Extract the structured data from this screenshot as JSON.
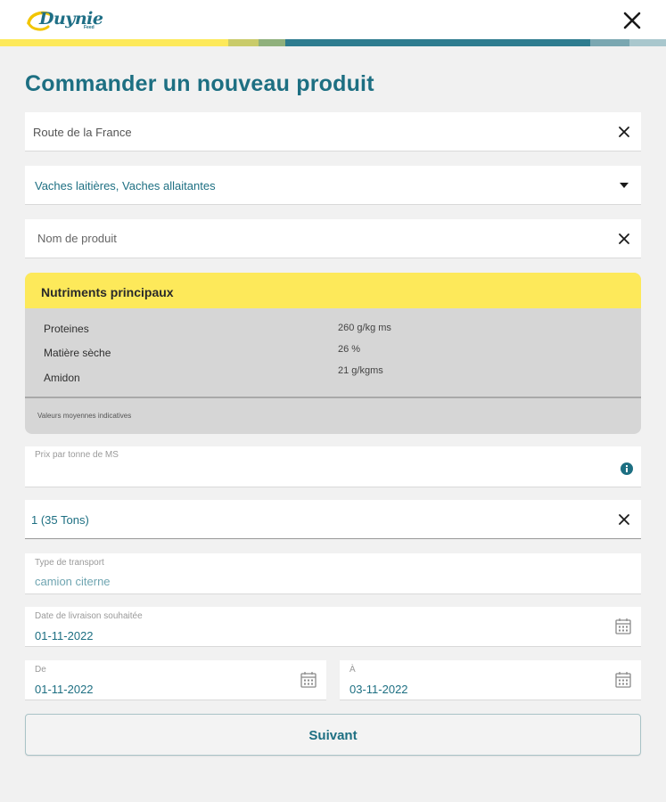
{
  "brand": {
    "name": "Duynie",
    "sub": "Feed"
  },
  "colors": {
    "teal": "#1d6f82",
    "yellow": "#fde95a",
    "bar": [
      "#fde95a",
      "#c9cb6a",
      "#8fb07c",
      "#2e7c8f",
      "#7aa7b1",
      "#a9c7cd"
    ]
  },
  "page": {
    "title": "Commander un nouveau produit"
  },
  "form": {
    "route": "Route de la France",
    "animals": "Vaches laitières, Vaches allaitantes",
    "product_placeholder": "Nom de produit",
    "price_label": "Prix par tonne de MS",
    "quantity": "1 (35 Tons)",
    "transport_label": "Type de transport",
    "transport_value": "camion citerne",
    "delivery_label": "Date de livraison souhaitée",
    "delivery_value": "01-11-2022",
    "from_label": "De",
    "from_value": "01-11-2022",
    "to_label": "À",
    "to_value": "03-11-2022"
  },
  "nutrients": {
    "title": "Nutriments principaux",
    "rows": [
      {
        "name": "Proteines",
        "value": "260 g/kg ms"
      },
      {
        "name": "Matière sèche",
        "value": "26 %"
      },
      {
        "name": "Amidon",
        "value": "21 g/kgms"
      }
    ],
    "footer": "Valeurs moyennes indicatives"
  },
  "actions": {
    "next": "Suivant"
  },
  "icons": [
    "close-icon",
    "clear-icon",
    "dropdown-arrow-icon",
    "info-icon",
    "calendar-icon"
  ]
}
